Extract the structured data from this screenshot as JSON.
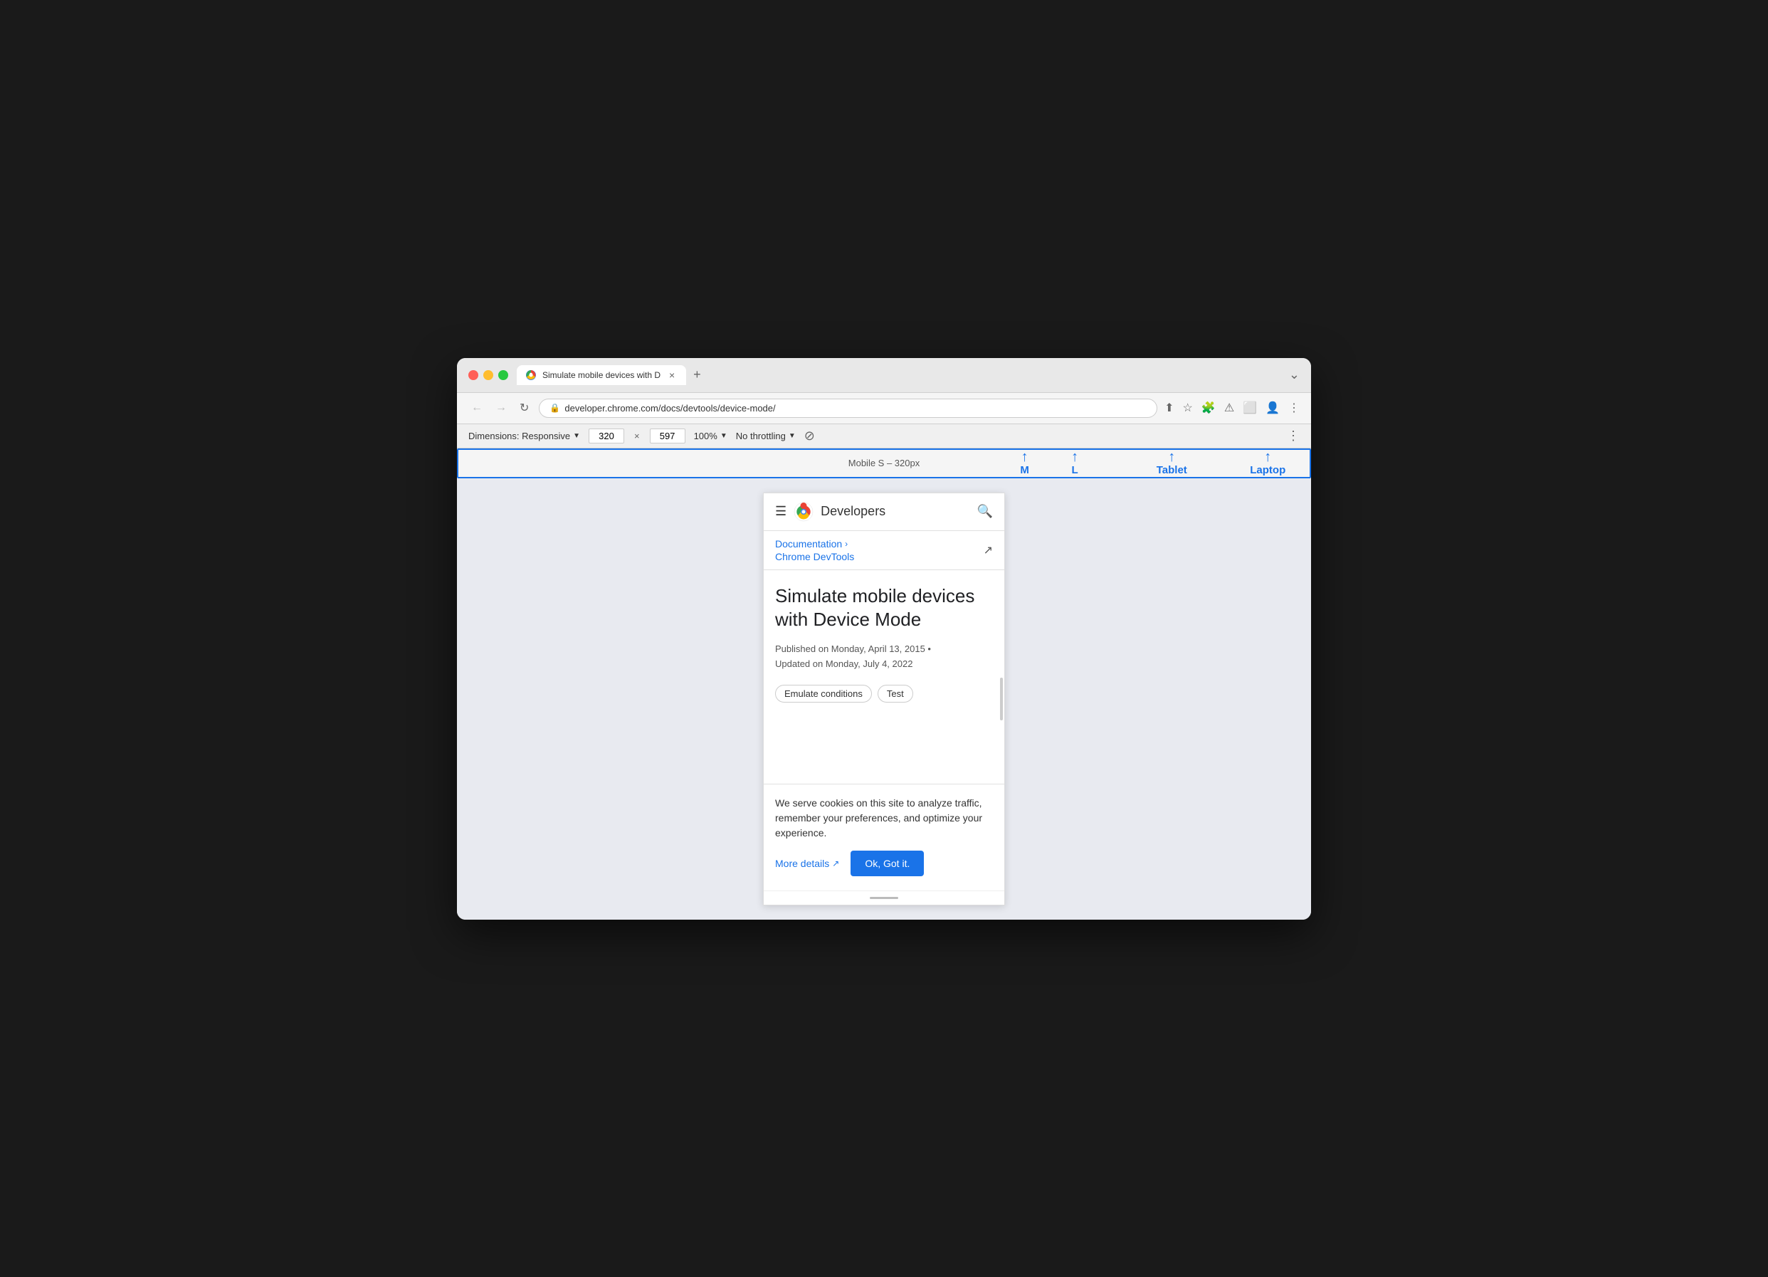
{
  "browser": {
    "tab_title": "Simulate mobile devices with D",
    "tab_close": "×",
    "tab_new": "+",
    "tab_end": "⌄",
    "url": "developer.chrome.com/docs/devtools/device-mode/",
    "nav_back": "←",
    "nav_forward": "→",
    "nav_reload": "↻"
  },
  "devtools": {
    "dimensions_label": "Dimensions: Responsive",
    "width_value": "320",
    "height_value": "597",
    "zoom_label": "100%",
    "throttle_label": "No throttling",
    "more_options": "⋮"
  },
  "responsive_bar": {
    "label": "Mobile S – 320px",
    "breakpoints": [
      {
        "label": "M",
        "position": 66
      },
      {
        "label": "L",
        "position": 72.5
      },
      {
        "label": "Tablet",
        "position": 84
      },
      {
        "label": "Laptop",
        "position": 96.5
      }
    ]
  },
  "mobile_page": {
    "site_title": "Developers",
    "breadcrumb1": "Documentation",
    "breadcrumb2": "Chrome DevTools",
    "article_title": "Simulate mobile devices with Device Mode",
    "published": "Published on Monday, April 13, 2015 •",
    "updated": "Updated on Monday, July 4, 2022",
    "tag1": "Emulate conditions",
    "tag2": "Test"
  },
  "cookie_banner": {
    "text": "We serve cookies on this site to analyze traffic, remember your preferences, and optimize your experience.",
    "more_details": "More details",
    "ok_button": "Ok, Got it."
  }
}
